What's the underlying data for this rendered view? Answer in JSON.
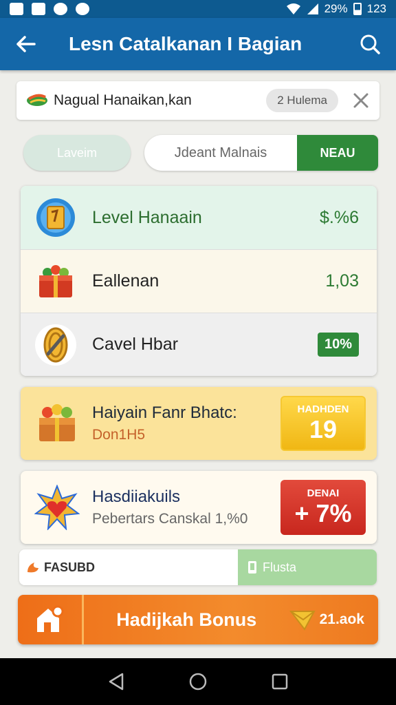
{
  "status_bar": {
    "battery_text": "29%",
    "time_text": "123"
  },
  "app_bar": {
    "title": "Lesn Catalkanan I Bagian"
  },
  "info_card": {
    "name": "Nagual Hanaikan,kan",
    "pill": "2 Hulema"
  },
  "controls": {
    "left_button": "Laveim",
    "input_placeholder": "Jdeant Malnais",
    "action_button": "NEAU"
  },
  "stats": [
    {
      "label": "Level Hanaain",
      "value": "$.%6"
    },
    {
      "label": "Eallenan",
      "value": "1,03"
    },
    {
      "label": "Cavel Hbar",
      "value": "10%"
    }
  ],
  "promos": [
    {
      "title": "Haiyain Fanr Bhatc:",
      "subtitle": "Don1H5",
      "badge_label": "HADHDEN",
      "badge_value": "19"
    },
    {
      "title": "Hasdiiakuils",
      "subtitle": "Pebertars Canskal 1,%0",
      "badge_label": "DENAI",
      "badge_value": "+ 7%"
    }
  ],
  "split_bar": {
    "left_label": "FASUBD",
    "right_label": "Flusta"
  },
  "bonus_bar": {
    "label": "Hadijkah Bonus",
    "right_label": "21.aok"
  },
  "colors": {
    "primary": "#1467a8",
    "green": "#2f8a3a",
    "orange": "#ee6e18",
    "gold": "#f0b714",
    "red": "#d2322a"
  }
}
